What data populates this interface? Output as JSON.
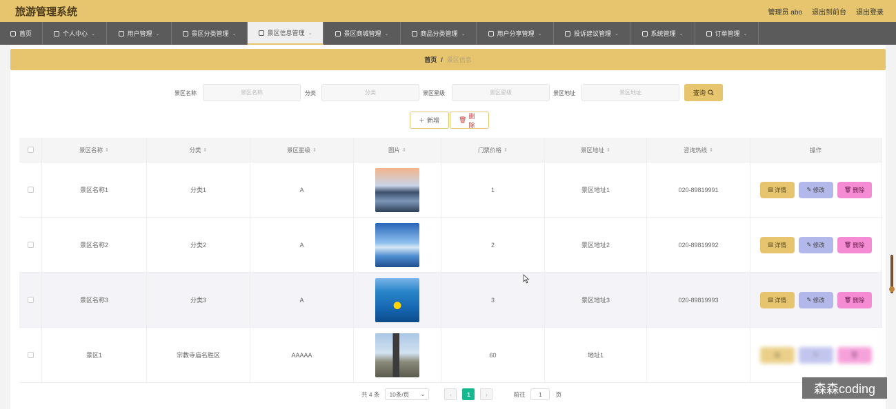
{
  "app": {
    "title": "旅游管理系统",
    "admin": "管理员 abo",
    "to_frontend": "退出到前台",
    "logout": "退出登录"
  },
  "nav": [
    {
      "label": "首页",
      "icon": "home-icon"
    },
    {
      "label": "个人中心",
      "icon": "user-icon"
    },
    {
      "label": "用户管理",
      "icon": "list-icon"
    },
    {
      "label": "景区分类管理",
      "icon": "sliders-icon"
    },
    {
      "label": "景区信息管理",
      "icon": "building-icon",
      "active": true
    },
    {
      "label": "景区商城管理",
      "icon": "pin-icon"
    },
    {
      "label": "商品分类管理",
      "icon": "shop-icon"
    },
    {
      "label": "用户分享管理",
      "icon": "share-icon"
    },
    {
      "label": "投诉建议管理",
      "icon": "clock-icon"
    },
    {
      "label": "系统管理",
      "icon": "gear-icon"
    },
    {
      "label": "订单管理",
      "icon": "order-icon"
    }
  ],
  "breadcrumb": {
    "home": "首页",
    "sep": "/",
    "current": "景区信息"
  },
  "search": {
    "name_label": "景区名称",
    "name_placeholder": "景区名称",
    "cat_label": "分类",
    "cat_placeholder": "分类",
    "level_label": "景区星级",
    "level_placeholder": "景区星级",
    "addr_label": "景区地址",
    "addr_placeholder": "景区地址",
    "query": "查询"
  },
  "actions": {
    "add": "新增",
    "delete": "删除"
  },
  "table": {
    "headers": [
      "景区名称",
      "分类",
      "景区星级",
      "图片",
      "门票价格",
      "景区地址",
      "咨询热线",
      "操作"
    ],
    "rows": [
      {
        "name": "景区名称1",
        "cat": "分类1",
        "level": "A",
        "price": "1",
        "addr": "景区地址1",
        "phone": "020-89819991",
        "img": "city-waterfront-photo"
      },
      {
        "name": "景区名称2",
        "cat": "分类2",
        "level": "A",
        "price": "2",
        "addr": "景区地址2",
        "phone": "020-89819992",
        "img": "arch-bridge-photo"
      },
      {
        "name": "景区名称3",
        "cat": "分类3",
        "level": "A",
        "price": "3",
        "addr": "景区地址3",
        "phone": "020-89819993",
        "img": "pool-duck-photo"
      },
      {
        "name": "景区1",
        "cat": "宗教寺庙名胜区",
        "level": "AAAAA",
        "price": "60",
        "addr": "地址1",
        "phone": "",
        "img": "monument-photo"
      }
    ],
    "ops": {
      "detail": "详情",
      "edit": "修改",
      "delete": "删除"
    }
  },
  "pager": {
    "total": "共 4 条",
    "size": "10条/页",
    "current": "1",
    "goto": "前往",
    "page_unit": "页",
    "jump_value": "1"
  },
  "watermark": "森森coding"
}
